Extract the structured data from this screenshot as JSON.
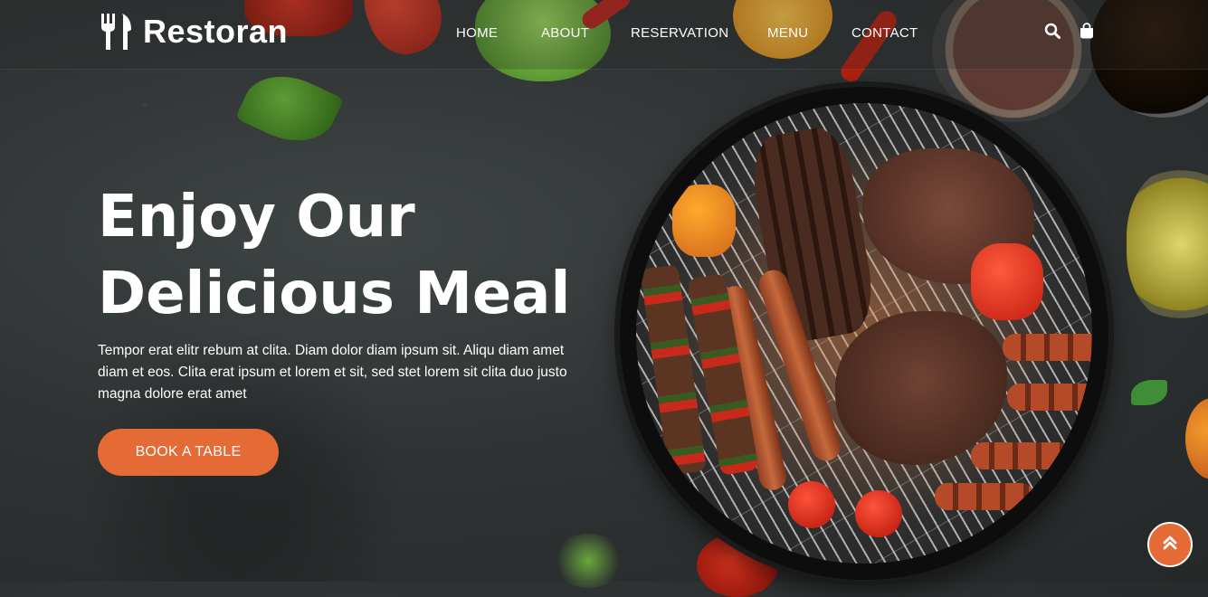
{
  "brand": {
    "name": "Restoran",
    "icon": "utensils-icon"
  },
  "nav": {
    "items": [
      {
        "label": "HOME"
      },
      {
        "label": "ABOUT"
      },
      {
        "label": "RESERVATION"
      },
      {
        "label": "MENU"
      },
      {
        "label": "CONTACT"
      }
    ],
    "icons": [
      "search-icon",
      "shopping-bag-icon"
    ]
  },
  "hero": {
    "title_line1": "Enjoy Our",
    "title_line2": "Delicious Meal",
    "description": "Tempor erat elitr rebum at clita. Diam dolor diam ipsum sit. Aliqu diam amet diam et eos. Clita erat ipsum et lorem et sit, sed stet lorem sit clita duo justo magna dolore erat amet",
    "cta_label": "BOOK A TABLE"
  },
  "back_to_top": {
    "icon": "double-chevron-up-icon"
  },
  "colors": {
    "accent": "#e46a36",
    "background": "#2f3333",
    "text": "#ffffff"
  }
}
